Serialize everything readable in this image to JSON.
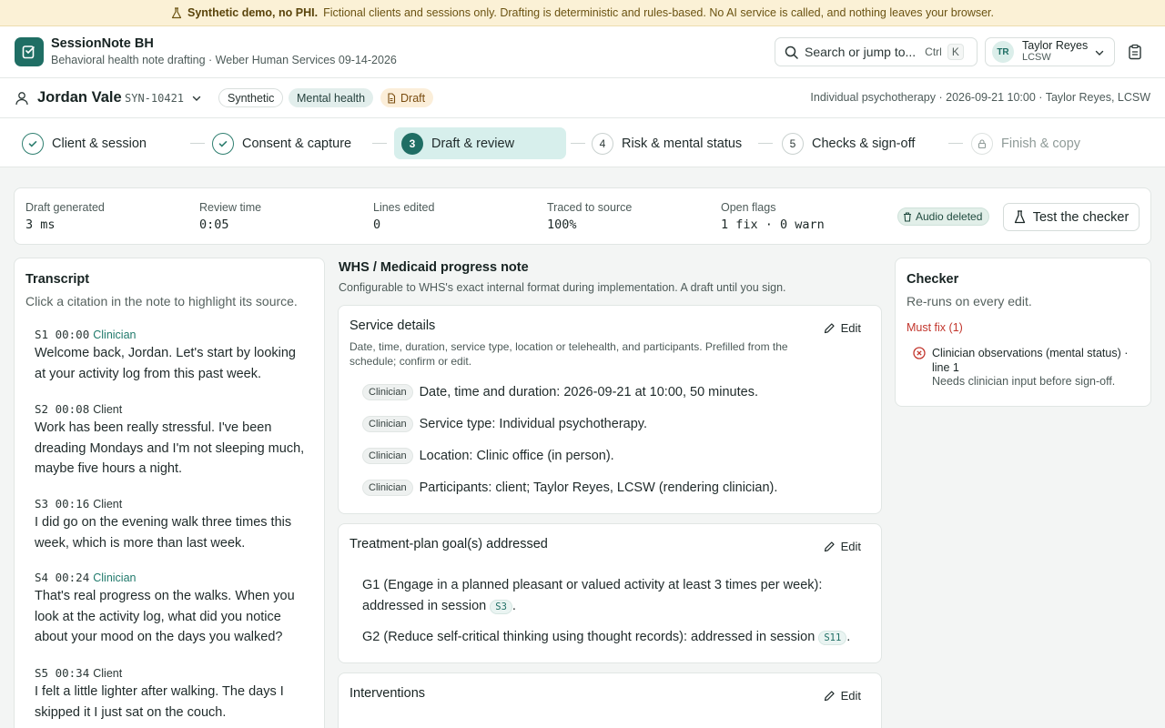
{
  "banner": {
    "bold": "Synthetic demo, no PHI.",
    "text": "Fictional clients and sessions only. Drafting is deterministic and rules-based. No AI service is called, and nothing leaves your browser."
  },
  "header": {
    "app_name": "SessionNote BH",
    "subtitle": "Behavioral health note drafting · Weber Human Services 09-14-2026",
    "search_placeholder": "Search or jump to...",
    "shortcut_mod": "Ctrl",
    "shortcut_key": "K",
    "user": {
      "initials": "TR",
      "name": "Taylor Reyes",
      "role": "LCSW"
    }
  },
  "client": {
    "name": "Jordan Vale",
    "id": "SYN-10421",
    "pills": {
      "synthetic": "Synthetic",
      "category": "Mental health",
      "status": "Draft"
    },
    "session_info": "Individual psychotherapy · 2026-09-21 10:00 · Taylor Reyes, LCSW"
  },
  "steps": [
    {
      "label": "Client & session",
      "state": "done"
    },
    {
      "label": "Consent & capture",
      "state": "done"
    },
    {
      "num": "3",
      "label": "Draft & review",
      "state": "active"
    },
    {
      "num": "4",
      "label": "Risk & mental status",
      "state": "todo"
    },
    {
      "num": "5",
      "label": "Checks & sign-off",
      "state": "todo"
    },
    {
      "label": "Finish & copy",
      "state": "locked"
    }
  ],
  "metrics": [
    {
      "label": "Draft generated",
      "value": "3 ms"
    },
    {
      "label": "Review time",
      "value": "0:05"
    },
    {
      "label": "Lines edited",
      "value": "0"
    },
    {
      "label": "Traced to source",
      "value": "100%"
    },
    {
      "label": "Open flags",
      "value": "1 fix · 0 warn"
    }
  ],
  "audio_badge": "Audio deleted",
  "test_button": "Test the checker",
  "transcript": {
    "title": "Transcript",
    "subtitle": "Click a citation in the note to highlight its source.",
    "utterances": [
      {
        "id": "S1",
        "time": "00:00",
        "speaker": "Clinician",
        "text": "Welcome back, Jordan. Let's start by looking at your activity log from this past week."
      },
      {
        "id": "S2",
        "time": "00:08",
        "speaker": "Client",
        "text": "Work has been really stressful. I've been dreading Mondays and I'm not sleeping much, maybe five hours a night."
      },
      {
        "id": "S3",
        "time": "00:16",
        "speaker": "Client",
        "text": "I did go on the evening walk three times this week, which is more than last week."
      },
      {
        "id": "S4",
        "time": "00:24",
        "speaker": "Clinician",
        "text": "That's real progress on the walks. When you look at the activity log, what did you notice about your mood on the days you walked?"
      },
      {
        "id": "S5",
        "time": "00:34",
        "speaker": "Client",
        "text": "I felt a little lighter after walking. The days I skipped it I just sat on the couch."
      }
    ]
  },
  "note": {
    "title": "WHS / Medicaid progress note",
    "subtitle": "Configurable to WHS's exact internal format during implementation. A draft until you sign.",
    "edit_label": "Edit",
    "service": {
      "title": "Service details",
      "description": "Date, time, duration, service type, location or telehealth, and participants. Prefilled from the schedule; confirm or edit.",
      "tag": "Clinician",
      "rows": [
        "Date, time and duration: 2026-09-21 at 10:00, 50 minutes.",
        "Service type: Individual psychotherapy.",
        "Location: Clinic office (in person).",
        "Participants: client; Taylor Reyes, LCSW (rendering clinician)."
      ]
    },
    "goals": {
      "title": "Treatment-plan goal(s) addressed",
      "items": [
        {
          "text": "G1 (Engage in a planned pleasant or valued activity at least 3 times per week): addressed in session",
          "cite": "S3"
        },
        {
          "text": "G2 (Reduce self-critical thinking using thought records): addressed in session",
          "cite": "S11"
        }
      ]
    },
    "interventions": {
      "title": "Interventions"
    }
  },
  "checker": {
    "title": "Checker",
    "subtitle": "Re-runs on every edit.",
    "must_fix": "Must fix (1)",
    "issue_title": "Clinician observations (mental status) · line 1",
    "issue_hint": "Needs clinician input before sign-off."
  },
  "colors": {
    "brand": "#1f6e64",
    "warn_bg": "#fbf1d6",
    "error": "#c2362d",
    "active_step_bg": "#d7efec"
  }
}
